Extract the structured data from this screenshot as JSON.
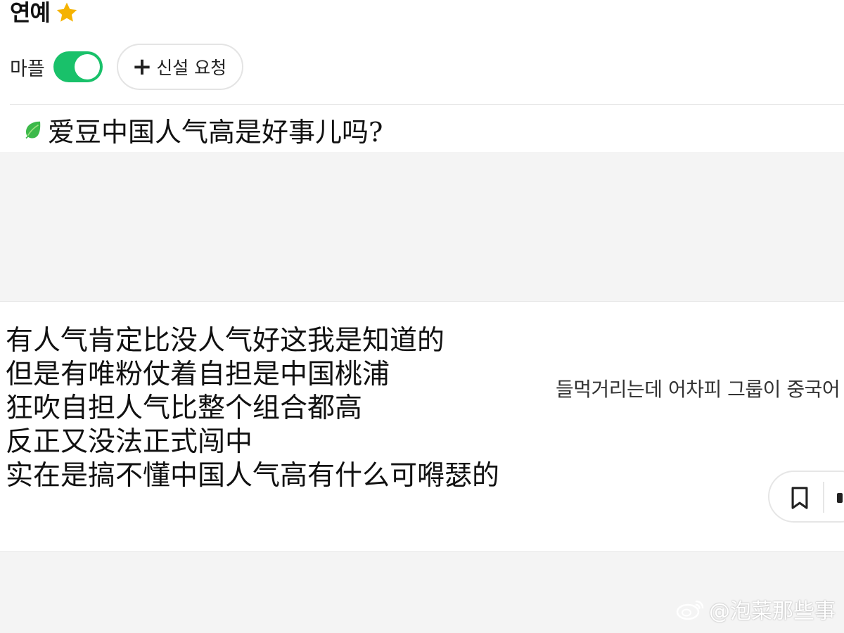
{
  "header": {
    "category_title": "연예",
    "star_icon": "star-icon"
  },
  "filters": {
    "maple_label": "마플",
    "maple_toggle_on": true,
    "request_button_label": "신설 요청"
  },
  "post": {
    "title": "爱豆中国人气高是好事儿吗?",
    "title_icon": "leaf-icon",
    "korean_snippet": "들먹거리는데 어차피 그룹이 중국어",
    "body_lines": [
      "有人气肯定比没人气好这我是知道的",
      "但是有唯粉仗着自担是中国桃浦",
      "狂吹自担人气比整个组合都高",
      "反正又没法正式闯中",
      "实在是搞不懂中国人气高有什么可嘚瑟的"
    ]
  },
  "actions": {
    "bookmark_icon": "bookmark-icon",
    "more_icon": "more-icon"
  },
  "watermark": {
    "text": "@泡菜那些事"
  },
  "colors": {
    "toggle_on": "#19c16a",
    "star": "#f5b301",
    "leaf": "#3cb94a",
    "page_bg": "#f4f4f4"
  }
}
